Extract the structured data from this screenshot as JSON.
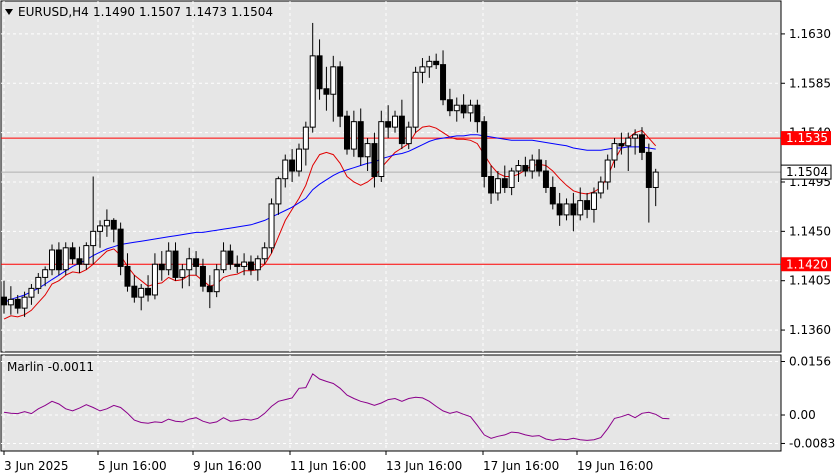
{
  "header": {
    "symbol_timeframe": "EURUSD,H4",
    "open": "1.1490",
    "high": "1.1507",
    "low": "1.1473",
    "close": "1.1504"
  },
  "indicator": {
    "name_value": "Marlin -0.0011"
  },
  "price_axis": {
    "ticks": [
      "1.1630",
      "1.1585",
      "1.1540",
      "1.1495",
      "1.1450",
      "1.1405",
      "1.1360"
    ]
  },
  "indicator_axis": {
    "ticks": [
      "0.0156",
      "0.00",
      "-0.0083"
    ]
  },
  "time_axis": {
    "labels": [
      "3 Jun 2025",
      "5 Jun 16:00",
      "9 Jun 16:00",
      "11 Jun 16:00",
      "13 Jun 16:00",
      "17 Jun 16:00",
      "19 Jun 16:00"
    ]
  },
  "levels": [
    {
      "label": "1.1535",
      "price": 1.1535
    },
    {
      "label": "1.1420",
      "price": 1.142
    }
  ],
  "current_price": {
    "label": "1.1504",
    "price": 1.1504
  },
  "colors": {
    "background": "#e6e6e6",
    "grid": "#ffffff",
    "candle": "#000000",
    "level_line": "#ff0000",
    "ma_blue": "#0000ff",
    "ma_red": "#e00000",
    "oscillator": "#8b008b"
  },
  "chart_data": {
    "type": "candlestick",
    "price_range": [
      1.134,
      1.166
    ],
    "indicator_range": [
      -0.0105,
      0.0175
    ],
    "candles": [
      [
        1.139,
        1.1405,
        1.1375,
        1.1383
      ],
      [
        1.1383,
        1.14,
        1.1374,
        1.1388
      ],
      [
        1.1388,
        1.1392,
        1.1375,
        1.138
      ],
      [
        1.138,
        1.1395,
        1.1372,
        1.139
      ],
      [
        1.139,
        1.1402,
        1.1383,
        1.1398
      ],
      [
        1.1398,
        1.1412,
        1.1393,
        1.1408
      ],
      [
        1.1408,
        1.1418,
        1.14,
        1.1415
      ],
      [
        1.1415,
        1.1438,
        1.141,
        1.1433
      ],
      [
        1.1433,
        1.144,
        1.141,
        1.1415
      ],
      [
        1.1415,
        1.144,
        1.141,
        1.1435
      ],
      [
        1.1435,
        1.144,
        1.142,
        1.1425
      ],
      [
        1.1425,
        1.1436,
        1.1412,
        1.142
      ],
      [
        1.142,
        1.144,
        1.1415,
        1.1437
      ],
      [
        1.1437,
        1.15,
        1.142,
        1.145
      ],
      [
        1.145,
        1.146,
        1.1435,
        1.1455
      ],
      [
        1.1455,
        1.147,
        1.1445,
        1.146
      ],
      [
        1.146,
        1.1462,
        1.144,
        1.1452
      ],
      [
        1.1452,
        1.1458,
        1.141,
        1.1418
      ],
      [
        1.1418,
        1.143,
        1.1395,
        1.14
      ],
      [
        1.14,
        1.141,
        1.1385,
        1.139
      ],
      [
        1.139,
        1.1402,
        1.1378,
        1.1398
      ],
      [
        1.1398,
        1.141,
        1.1386,
        1.1392
      ],
      [
        1.1392,
        1.143,
        1.1388,
        1.142
      ],
      [
        1.142,
        1.1432,
        1.1405,
        1.1415
      ],
      [
        1.1415,
        1.144,
        1.141,
        1.1432
      ],
      [
        1.1432,
        1.144,
        1.1405,
        1.1408
      ],
      [
        1.1408,
        1.142,
        1.1398,
        1.1415
      ],
      [
        1.1415,
        1.1435,
        1.14,
        1.1425
      ],
      [
        1.1425,
        1.1432,
        1.141,
        1.1418
      ],
      [
        1.1418,
        1.1425,
        1.1395,
        1.14
      ],
      [
        1.14,
        1.141,
        1.138,
        1.1395
      ],
      [
        1.1395,
        1.142,
        1.139,
        1.1415
      ],
      [
        1.1415,
        1.144,
        1.1412,
        1.1432
      ],
      [
        1.1432,
        1.1438,
        1.1415,
        1.142
      ],
      [
        1.142,
        1.1428,
        1.1412,
        1.1418
      ],
      [
        1.1418,
        1.143,
        1.141,
        1.1422
      ],
      [
        1.1422,
        1.1428,
        1.141,
        1.1415
      ],
      [
        1.1415,
        1.1428,
        1.1405,
        1.1425
      ],
      [
        1.1425,
        1.144,
        1.142,
        1.1435
      ],
      [
        1.1435,
        1.148,
        1.143,
        1.1475
      ],
      [
        1.1475,
        1.15,
        1.1465,
        1.1498
      ],
      [
        1.1498,
        1.152,
        1.149,
        1.1515
      ],
      [
        1.1515,
        1.1525,
        1.1495,
        1.1505
      ],
      [
        1.1505,
        1.153,
        1.15,
        1.1525
      ],
      [
        1.1525,
        1.155,
        1.151,
        1.1545
      ],
      [
        1.1545,
        1.164,
        1.154,
        1.161
      ],
      [
        1.161,
        1.1625,
        1.157,
        1.158
      ],
      [
        1.158,
        1.16,
        1.156,
        1.1575
      ],
      [
        1.1575,
        1.161,
        1.155,
        1.16
      ],
      [
        1.16,
        1.1605,
        1.1545,
        1.1555
      ],
      [
        1.1555,
        1.156,
        1.152,
        1.1525
      ],
      [
        1.1525,
        1.156,
        1.1518,
        1.155
      ],
      [
        1.155,
        1.1562,
        1.151,
        1.1518
      ],
      [
        1.1518,
        1.1535,
        1.1505,
        1.153
      ],
      [
        1.153,
        1.154,
        1.149,
        1.15
      ],
      [
        1.15,
        1.156,
        1.1495,
        1.155
      ],
      [
        1.155,
        1.1565,
        1.1535,
        1.1545
      ],
      [
        1.1545,
        1.156,
        1.154,
        1.1555
      ],
      [
        1.1555,
        1.157,
        1.1525,
        1.153
      ],
      [
        1.153,
        1.155,
        1.1525,
        1.1545
      ],
      [
        1.1545,
        1.16,
        1.154,
        1.1595
      ],
      [
        1.1595,
        1.1608,
        1.1585,
        1.16
      ],
      [
        1.16,
        1.161,
        1.159,
        1.1605
      ],
      [
        1.1605,
        1.1612,
        1.1598,
        1.1602
      ],
      [
        1.1602,
        1.1615,
        1.1565,
        1.157
      ],
      [
        1.157,
        1.158,
        1.1555,
        1.156
      ],
      [
        1.156,
        1.1572,
        1.155,
        1.1565
      ],
      [
        1.1565,
        1.1575,
        1.1553,
        1.1558
      ],
      [
        1.1558,
        1.157,
        1.155,
        1.1565
      ],
      [
        1.1565,
        1.157,
        1.154,
        1.155
      ],
      [
        1.155,
        1.1555,
        1.149,
        1.15
      ],
      [
        1.15,
        1.151,
        1.1475,
        1.1485
      ],
      [
        1.1485,
        1.1505,
        1.1478,
        1.1498
      ],
      [
        1.1498,
        1.151,
        1.1485,
        1.149
      ],
      [
        1.149,
        1.1508,
        1.1483,
        1.1505
      ],
      [
        1.1505,
        1.1515,
        1.1495,
        1.151
      ],
      [
        1.151,
        1.1518,
        1.15,
        1.1505
      ],
      [
        1.1505,
        1.152,
        1.1498,
        1.1515
      ],
      [
        1.1515,
        1.1525,
        1.15,
        1.1505
      ],
      [
        1.1505,
        1.1515,
        1.1485,
        1.149
      ],
      [
        1.149,
        1.15,
        1.147,
        1.1475
      ],
      [
        1.1475,
        1.1485,
        1.1455,
        1.1465
      ],
      [
        1.1465,
        1.148,
        1.146,
        1.1475
      ],
      [
        1.1475,
        1.1485,
        1.145,
        1.1465
      ],
      [
        1.1465,
        1.149,
        1.146,
        1.1478
      ],
      [
        1.1478,
        1.1485,
        1.1462,
        1.147
      ],
      [
        1.147,
        1.149,
        1.1458,
        1.1485
      ],
      [
        1.1485,
        1.15,
        1.148,
        1.1495
      ],
      [
        1.1495,
        1.152,
        1.1488,
        1.1515
      ],
      [
        1.1515,
        1.1535,
        1.1508,
        1.153
      ],
      [
        1.153,
        1.154,
        1.152,
        1.1528
      ],
      [
        1.1528,
        1.154,
        1.1505,
        1.1535
      ],
      [
        1.1535,
        1.1543,
        1.152,
        1.1538
      ],
      [
        1.1538,
        1.1545,
        1.1515,
        1.1522
      ],
      [
        1.1522,
        1.153,
        1.1458,
        1.149
      ],
      [
        1.149,
        1.1507,
        1.1473,
        1.1504
      ]
    ],
    "ma_blue": [
      1.1385,
      1.1388,
      1.139,
      1.1392,
      1.1395,
      1.1398,
      1.1402,
      1.1406,
      1.141,
      1.1414,
      1.1418,
      1.1421,
      1.1424,
      1.1428,
      1.1431,
      1.1434,
      1.1436,
      1.1438,
      1.1439,
      1.144,
      1.1441,
      1.1442,
      1.1443,
      1.1444,
      1.1445,
      1.1446,
      1.1447,
      1.1448,
      1.1449,
      1.1449,
      1.145,
      1.1451,
      1.1452,
      1.1453,
      1.1454,
      1.1455,
      1.1456,
      1.1458,
      1.146,
      1.1463,
      1.1466,
      1.1469,
      1.1472,
      1.1476,
      1.148,
      1.1488,
      1.1493,
      1.1497,
      1.1501,
      1.1504,
      1.1506,
      1.1508,
      1.151,
      1.1512,
      1.1513,
      1.1516,
      1.1518,
      1.152,
      1.1521,
      1.1523,
      1.1526,
      1.1529,
      1.1532,
      1.1534,
      1.1535,
      1.1536,
      1.1537,
      1.1537,
      1.1538,
      1.1538,
      1.1537,
      1.1536,
      1.1535,
      1.1534,
      1.1533,
      1.1533,
      1.1533,
      1.1533,
      1.1532,
      1.1531,
      1.153,
      1.1529,
      1.1528,
      1.1526,
      1.1525,
      1.1524,
      1.1524,
      1.1524,
      1.1525,
      1.1526,
      1.1526,
      1.1527,
      1.1527,
      1.1527,
      1.1526,
      1.1525
    ],
    "ma_red": [
      1.137,
      1.1373,
      1.1372,
      1.1374,
      1.1378,
      1.1385,
      1.1392,
      1.1402,
      1.1405,
      1.141,
      1.1413,
      1.1412,
      1.1415,
      1.142,
      1.1426,
      1.1432,
      1.1434,
      1.1428,
      1.1418,
      1.141,
      1.1405,
      1.14,
      1.1402,
      1.1403,
      1.1408,
      1.1405,
      1.1406,
      1.141,
      1.141,
      1.1405,
      1.14,
      1.1402,
      1.1408,
      1.141,
      1.1411,
      1.1414,
      1.1414,
      1.1415,
      1.142,
      1.143,
      1.1445,
      1.146,
      1.147,
      1.148,
      1.1492,
      1.151,
      1.152,
      1.1522,
      1.152,
      1.1512,
      1.15,
      1.1495,
      1.1492,
      1.1495,
      1.15,
      1.1508,
      1.1515,
      1.1522,
      1.1526,
      1.153,
      1.154,
      1.1545,
      1.1546,
      1.1544,
      1.154,
      1.1536,
      1.1534,
      1.1534,
      1.1533,
      1.153,
      1.152,
      1.151,
      1.1503,
      1.15,
      1.15,
      1.1502,
      1.1506,
      1.151,
      1.1511,
      1.151,
      1.1505,
      1.1498,
      1.1492,
      1.1487,
      1.1485,
      1.1484,
      1.1486,
      1.149,
      1.15,
      1.1515,
      1.1526,
      1.1535,
      1.154,
      1.1542,
      1.1535,
      1.1528
    ],
    "oscillator": [
      0.0008,
      0.0005,
      0.0004,
      0.001,
      0.0004,
      0.0018,
      0.0028,
      0.004,
      0.0032,
      0.0018,
      0.0012,
      0.002,
      0.003,
      0.0022,
      0.0012,
      0.0018,
      0.0028,
      0.0022,
      0.0005,
      -0.0015,
      -0.0022,
      -0.0024,
      -0.002,
      -0.0022,
      -0.0012,
      -0.0018,
      -0.002,
      -0.0012,
      -0.0008,
      -0.0018,
      -0.0024,
      -0.002,
      -0.0008,
      -0.0018,
      -0.0016,
      -0.0012,
      -0.0015,
      -0.001,
      0.0005,
      0.0025,
      0.004,
      0.0045,
      0.005,
      0.0078,
      0.008,
      0.012,
      0.0105,
      0.0098,
      0.0092,
      0.0078,
      0.0058,
      0.0048,
      0.004,
      0.0035,
      0.0028,
      0.0035,
      0.0045,
      0.0048,
      0.004,
      0.0048,
      0.0052,
      0.005,
      0.004,
      0.0025,
      0.0012,
      0.0005,
      0.001,
      0.0002,
      -0.0005,
      -0.003,
      -0.0058,
      -0.0068,
      -0.0062,
      -0.0058,
      -0.005,
      -0.0052,
      -0.0058,
      -0.0062,
      -0.006,
      -0.007,
      -0.0074,
      -0.007,
      -0.0072,
      -0.0068,
      -0.0072,
      -0.0074,
      -0.0072,
      -0.0066,
      -0.004,
      -0.001,
      -0.0005,
      0.0002,
      -0.0008,
      0.0005,
      0.0008,
      0.0002,
      -0.001,
      -0.0011
    ]
  }
}
